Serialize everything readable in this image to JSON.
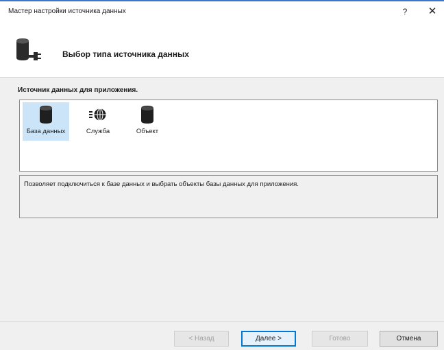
{
  "window": {
    "title": "Мастер настройки источника данных",
    "help_label": "?",
    "close_label": "✕"
  },
  "header": {
    "title": "Выбор типа источника данных",
    "icon": "database-plug-icon"
  },
  "source_section": {
    "label": "Источник данных для приложения.",
    "items": [
      {
        "label": "База данных",
        "icon": "database-icon",
        "selected": true
      },
      {
        "label": "Служба",
        "icon": "web-service-icon",
        "selected": false
      },
      {
        "label": "Объект",
        "icon": "object-icon",
        "selected": false
      }
    ]
  },
  "description": "Позволяет подключиться к базе данных и выбрать объекты базы данных для приложения.",
  "buttons": {
    "back": "< Назад",
    "next": "Далее >",
    "finish": "Готово",
    "cancel": "Отмена"
  },
  "colors": {
    "accent": "#0078d7",
    "selection": "#cce4f7",
    "window_border": "#3a76c9"
  }
}
